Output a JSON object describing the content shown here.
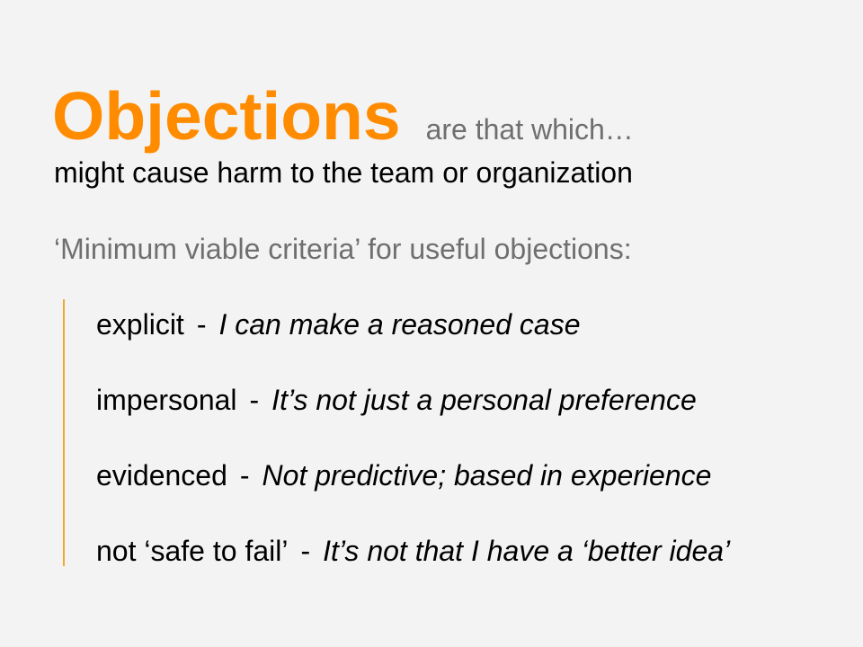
{
  "slide": {
    "title": "Objections",
    "title_tail": "are that which…",
    "subtitle": "might cause harm to the team or organization",
    "criteria_heading": "‘Minimum viable criteria’ for useful objections:",
    "separator": "-",
    "criteria": [
      {
        "term": "explicit",
        "description": "I can make a reasoned case"
      },
      {
        "term": "impersonal",
        "description": "It’s not just a personal preference"
      },
      {
        "term": "evidenced",
        "description": "Not predictive; based in experience"
      },
      {
        "term": "not ‘safe to fail’",
        "description": "It’s not that I have a ‘better idea’"
      }
    ]
  },
  "colors": {
    "accent": "#ff8c00",
    "muted_text": "#6f6f6f",
    "bar": "#f0a830",
    "background": "#f3f3f3"
  }
}
